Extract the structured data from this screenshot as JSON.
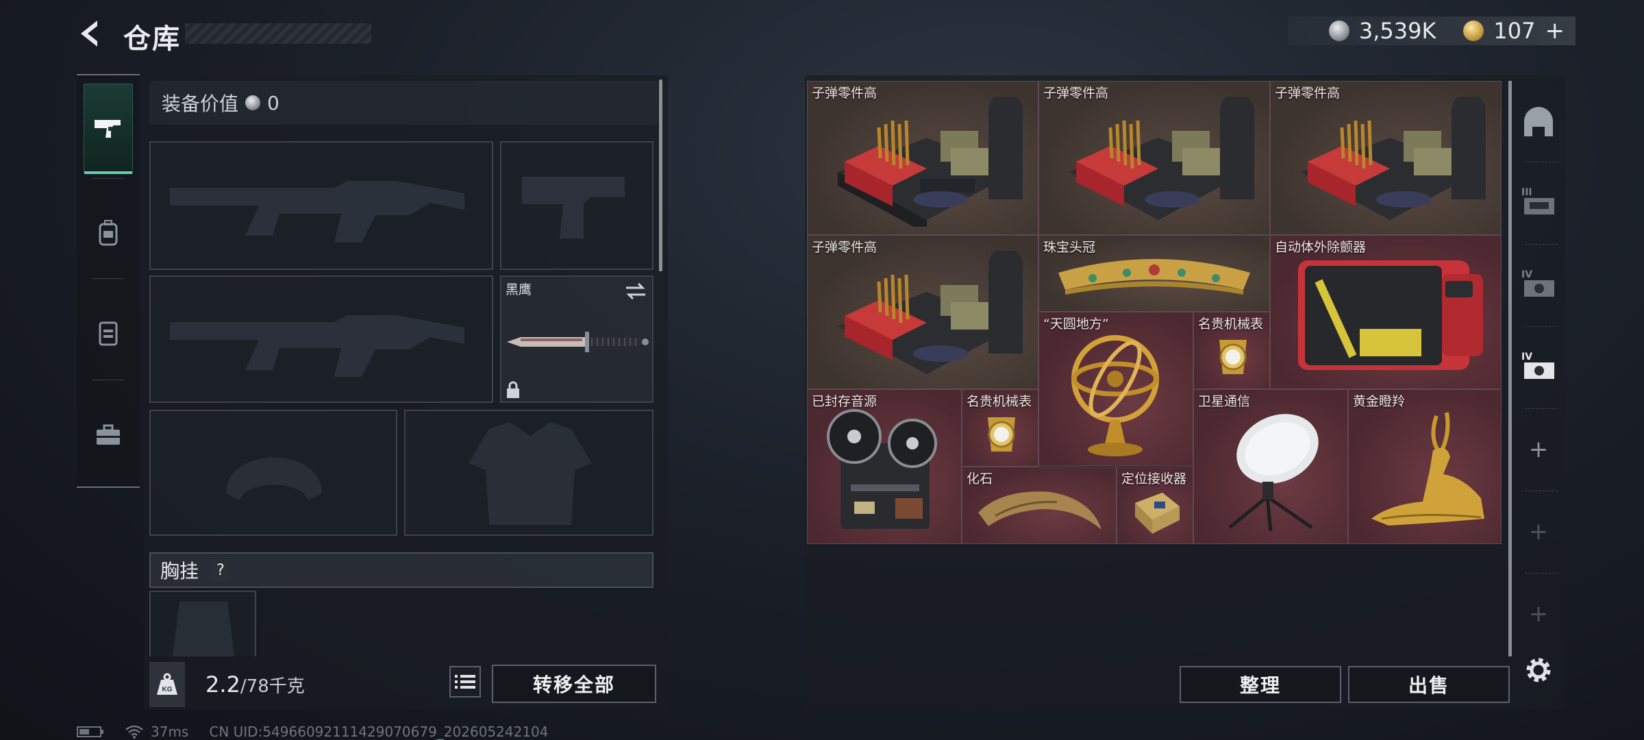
{
  "header": {
    "title": "仓库",
    "silver_amount": "3,539K",
    "gold_amount": "107",
    "gold_add": "+"
  },
  "left": {
    "equip_value_label": "装备价值",
    "equip_value": "0",
    "melee_slot_label": "黑鹰",
    "chest_label": "胸挂",
    "chest_help": "?",
    "weight_current": "2.2",
    "weight_max": "/78千克",
    "transfer_all": "转移全部"
  },
  "right": {
    "items": [
      {
        "name": "子弹零件高",
        "bg": "brown"
      },
      {
        "name": "子弹零件高",
        "bg": "brown"
      },
      {
        "name": "子弹零件高",
        "bg": "brown"
      },
      {
        "name": "子弹零件高",
        "bg": "brown"
      },
      {
        "name": "珠宝头冠",
        "bg": "red"
      },
      {
        "name": "自动体外除颤器",
        "bg": "red"
      },
      {
        "name": "“天圆地方”",
        "bg": "red"
      },
      {
        "name": "名贵机械表",
        "bg": "red"
      },
      {
        "name": "已封存音源",
        "bg": "red"
      },
      {
        "name": "名贵机械表",
        "bg": "red"
      },
      {
        "name": "化石",
        "bg": "red"
      },
      {
        "name": "定位接收器",
        "bg": "red"
      },
      {
        "name": "卫星通信",
        "bg": "red"
      },
      {
        "name": "黄金瞪羚",
        "bg": "red"
      }
    ],
    "sort_button": "整理",
    "sell_button": "出售",
    "rail_plus": "+"
  },
  "status": {
    "ping": "37ms",
    "uid": "CN UID:5496609211142907067​9_202605242104"
  },
  "colors": {
    "accent": "#5fd0b0",
    "item_brown": "#4a3e38",
    "item_red": "#582e36"
  }
}
